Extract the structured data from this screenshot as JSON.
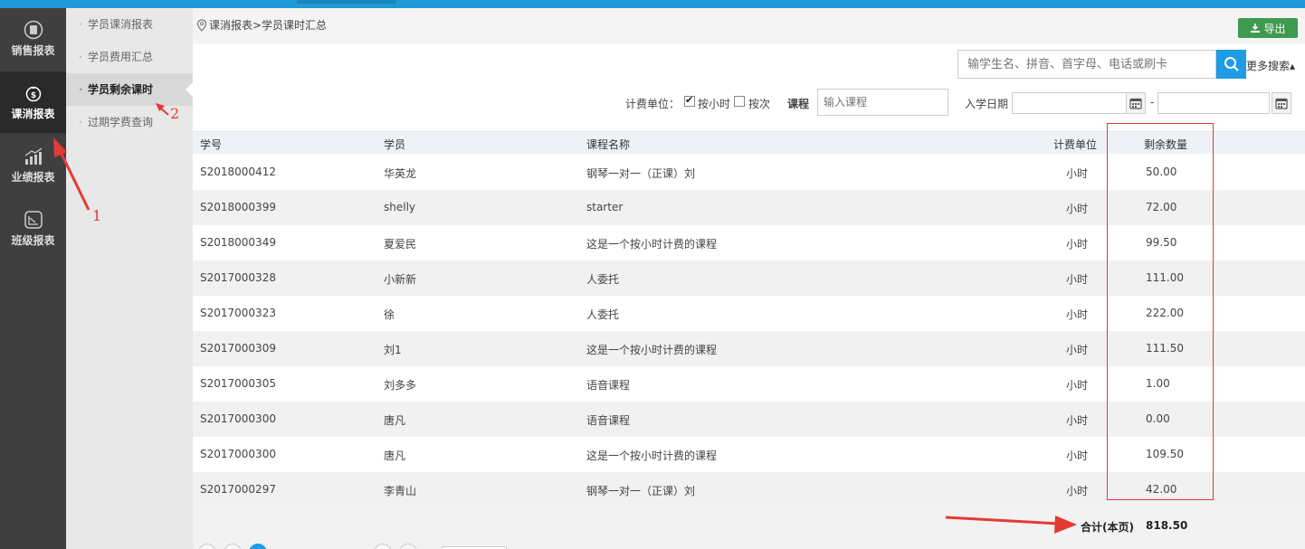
{
  "colors": {
    "accent": "#1e9ce8",
    "export": "#3e9a4f",
    "annotation": "#e53935",
    "nav_bg": "#3f3f3f"
  },
  "leftnav": {
    "items": [
      {
        "label": "销售报表",
        "icon": "sales-icon",
        "active": false
      },
      {
        "label": "课消报表",
        "icon": "money-bag-icon",
        "active": true
      },
      {
        "label": "业绩报表",
        "icon": "bar-chart-icon",
        "active": false
      },
      {
        "label": "班级报表",
        "icon": "line-chart-icon",
        "active": false
      }
    ]
  },
  "submenu": {
    "items": [
      {
        "label": "学员课消报表",
        "active": false
      },
      {
        "label": "学员费用汇总",
        "active": false
      },
      {
        "label": "学员剩余课时",
        "active": true
      },
      {
        "label": "过期学费查询",
        "active": false
      }
    ]
  },
  "header": {
    "breadcrumb": "课消报表>学员课时汇总",
    "export_label": "导出"
  },
  "search": {
    "placeholder": "输学生名、拼音、首字母、电话或刷卡",
    "more_label": "更多搜索▴"
  },
  "filters": {
    "billing_unit_label": "计费单位：",
    "by_hour_label": "按小时",
    "by_hour_checked": true,
    "by_times_label": "按次",
    "by_times_checked": false,
    "course_label": "课程",
    "course_placeholder": "输入课程",
    "enroll_date_label": "入学日期",
    "date_separator": "-"
  },
  "table": {
    "headers": {
      "id": "学号",
      "student": "学员",
      "course": "课程名称",
      "unit": "计费单位",
      "remaining": "剩余数量"
    },
    "rows": [
      {
        "id": "S2018000412",
        "student": "华英龙",
        "course": "钢琴一对一（正课）刘",
        "unit": "小时",
        "remaining": "50.00"
      },
      {
        "id": "S2018000399",
        "student": "shelly",
        "course": "starter",
        "unit": "小时",
        "remaining": "72.00"
      },
      {
        "id": "S2018000349",
        "student": "夏爱民",
        "course": "这是一个按小时计费的课程",
        "unit": "小时",
        "remaining": "99.50"
      },
      {
        "id": "S2017000328",
        "student": "小新新",
        "course": "人委托",
        "unit": "小时",
        "remaining": "111.00"
      },
      {
        "id": "S2017000323",
        "student": "徐",
        "course": "人委托",
        "unit": "小时",
        "remaining": "222.00"
      },
      {
        "id": "S2017000309",
        "student": "刘1",
        "course": "这是一个按小时计费的课程",
        "unit": "小时",
        "remaining": "111.50"
      },
      {
        "id": "S2017000305",
        "student": "刘多多",
        "course": "语音课程",
        "unit": "小时",
        "remaining": "1.00"
      },
      {
        "id": "S2017000300",
        "student": "唐凡",
        "course": "语音课程",
        "unit": "小时",
        "remaining": "0.00"
      },
      {
        "id": "S2017000300",
        "student": "唐凡",
        "course": "这是一个按小时计费的课程",
        "unit": "小时",
        "remaining": "109.50"
      },
      {
        "id": "S2017000297",
        "student": "李青山",
        "course": "钢琴一对一（正课）刘",
        "unit": "小时",
        "remaining": "42.00"
      }
    ]
  },
  "footer": {
    "total_label": "合计(本页)",
    "total_value": "818.50"
  },
  "annotations": {
    "step1": "1",
    "step2": "2"
  }
}
